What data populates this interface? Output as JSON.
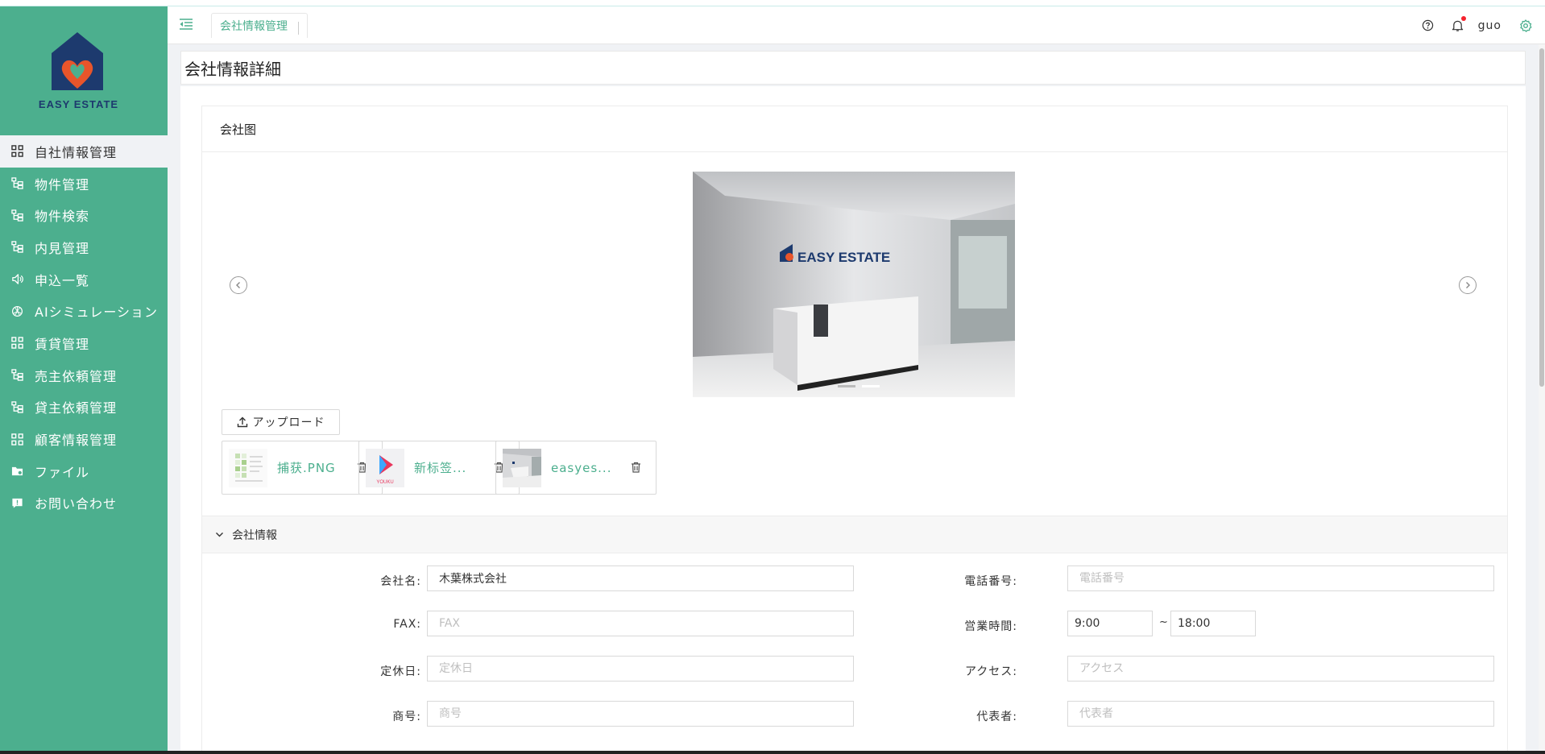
{
  "brand": {
    "logo_text": "EASY ESTATE"
  },
  "sidebar": {
    "items": [
      {
        "label": "自社情報管理",
        "icon": "dashboard-icon",
        "active": true
      },
      {
        "label": "物件管理",
        "icon": "tree-icon"
      },
      {
        "label": "物件検索",
        "icon": "tree-icon"
      },
      {
        "label": "内見管理",
        "icon": "tree-icon"
      },
      {
        "label": "申込一覧",
        "icon": "sound-icon"
      },
      {
        "label": "AIシミュレーション",
        "icon": "openai-icon"
      },
      {
        "label": "賃貸管理",
        "icon": "dashboard-icon"
      },
      {
        "label": "売主依頼管理",
        "icon": "tree-icon"
      },
      {
        "label": "貸主依頼管理",
        "icon": "tree-icon"
      },
      {
        "label": "顧客情報管理",
        "icon": "dashboard-icon"
      },
      {
        "label": "ファイル",
        "icon": "folder-icon"
      },
      {
        "label": "お問い合わせ",
        "icon": "message-icon"
      }
    ]
  },
  "header": {
    "tab_label": "会社情報管理",
    "user_name": "guo"
  },
  "page": {
    "title": "会社情報詳細"
  },
  "gallery": {
    "title": "会社图",
    "upload_label": "アップロード",
    "files": [
      {
        "name": "捕获.PNG"
      },
      {
        "name": "新标签..."
      },
      {
        "name": "easyes..."
      }
    ],
    "thumb_caption": "YOUKU"
  },
  "company_info": {
    "title": "会社情報",
    "fields": {
      "company_name": {
        "label": "会社名:",
        "value": "木葉株式会社",
        "placeholder": ""
      },
      "phone": {
        "label": "電話番号:",
        "value": "",
        "placeholder": "電話番号"
      },
      "fax": {
        "label": "FAX:",
        "value": "",
        "placeholder": "FAX"
      },
      "business_hours": {
        "label": "営業時間:",
        "start": "9:00",
        "end": "18:00",
        "separator": "~"
      },
      "holiday": {
        "label": "定休日:",
        "value": "",
        "placeholder": "定休日"
      },
      "access": {
        "label": "アクセス:",
        "value": "",
        "placeholder": "アクセス"
      },
      "trade_name": {
        "label": "商号:",
        "value": "",
        "placeholder": "商号"
      },
      "representative": {
        "label": "代表者:",
        "value": "",
        "placeholder": "代表者"
      }
    }
  },
  "colors": {
    "primary": "#4caf8e",
    "logo_navy": "#1d3a6e",
    "logo_orange": "#e8552b"
  }
}
